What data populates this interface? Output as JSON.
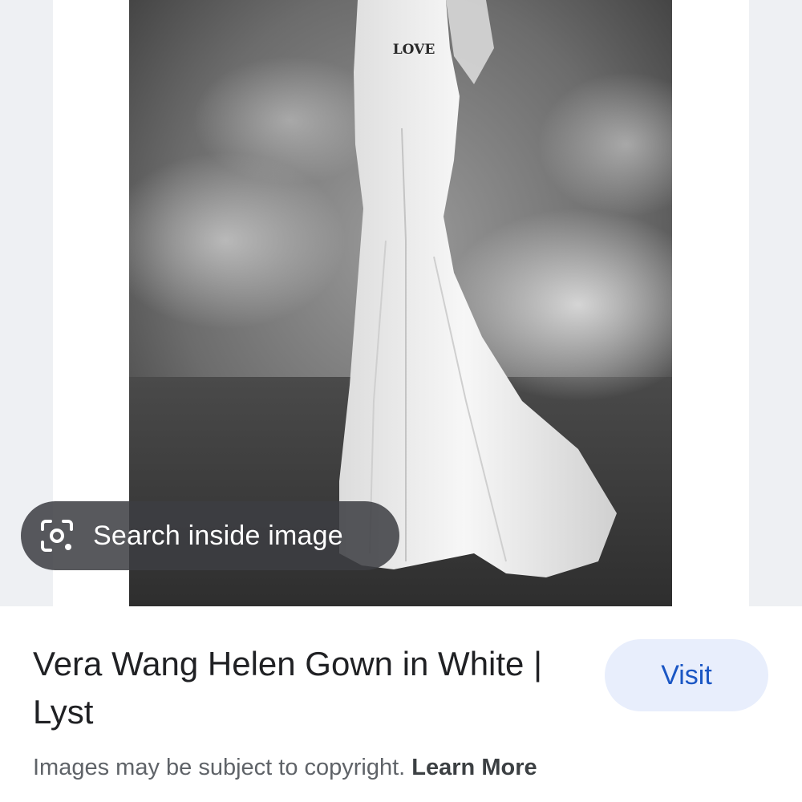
{
  "image_overlay": {
    "search_inside_label": "Search inside image",
    "icon": "lens-scan-icon"
  },
  "photo": {
    "waist_text": "LOVE"
  },
  "result": {
    "title": "Vera Wang Helen Gown in White | Lyst",
    "visit_label": "Visit"
  },
  "footer": {
    "copyright_text": "Images may be subject to copyright.",
    "learn_more_label": "Learn More"
  },
  "colors": {
    "visit_bg": "#e8eefc",
    "visit_text": "#1a56c4",
    "page_bg": "#eef0f3"
  }
}
